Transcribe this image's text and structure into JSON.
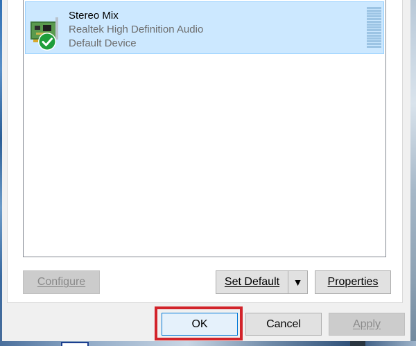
{
  "device_list": {
    "items": [
      {
        "name": "Stereo Mix",
        "driver": "Realtek High Definition Audio",
        "status": "Default Device",
        "icon": "sound-card-icon",
        "badge": "default-checkmark-icon",
        "selected": true
      }
    ]
  },
  "buttons": {
    "configure": "Configure",
    "set_default": "Set Default",
    "set_default_arrow": "▼",
    "properties": "Properties",
    "ok": "OK",
    "cancel": "Cancel",
    "apply": "Apply"
  },
  "colors": {
    "selection": "#cce8ff",
    "highlight_box": "#d2232a",
    "check_green": "#1e9e3a"
  }
}
